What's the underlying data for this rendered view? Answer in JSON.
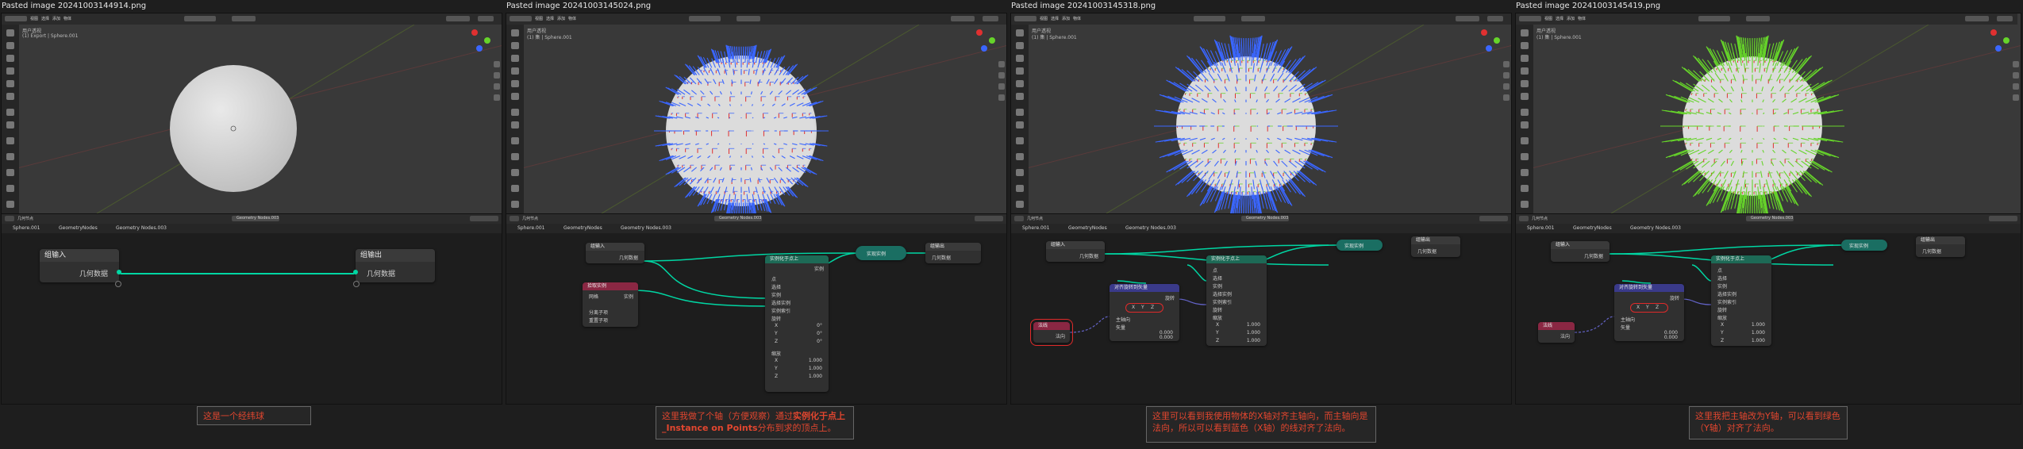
{
  "panels": [
    {
      "file_title": "Pasted image 20241003144914.png",
      "header_menu": [
        "物体模式",
        "视图",
        "选择",
        "添加",
        "物体"
      ],
      "viewport_info": [
        "用户透视",
        "(1) Export | Sphere.001"
      ],
      "editor_header": [
        "几何节点"
      ],
      "node_group": "Geometry Nodes.003",
      "breadcrumb": [
        "Sphere.001",
        "GeometryNodes",
        "Geometry Nodes.003"
      ],
      "nodes": {
        "group_input": {
          "title": "组输入",
          "socket": "几何数据"
        },
        "group_output": {
          "title": "组输出",
          "socket": "几何数据"
        }
      },
      "caption": "这是一个经纬球"
    },
    {
      "file_title": "Pasted image 20241003145024.png",
      "header_menu": [
        "物体模式",
        "视图",
        "选择",
        "添加",
        "物体"
      ],
      "viewport_info": [
        "用户透视",
        "(1) 集 | Sphere.001"
      ],
      "editor_header": [
        "几何节点"
      ],
      "node_group": "Geometry Nodes.003",
      "breadcrumb": [
        "Sphere.001",
        "GeometryNodes",
        "Geometry Nodes.003"
      ],
      "nodes": {
        "group_input": {
          "title": "组输入",
          "socket": "几何数据"
        },
        "group_output": {
          "title": "组输出",
          "socket": "几何数据"
        },
        "realize": {
          "title": "实现实例"
        },
        "instance": {
          "title": "实例化于点上",
          "rows": [
            "点",
            "选择",
            "实例",
            "选择实例",
            "实例索引",
            "旋转",
            "X",
            "Y",
            "Z",
            "缩放",
            "X",
            "Y",
            "Z"
          ],
          "values": [
            "0°",
            "0°",
            "0°",
            "1.000",
            "1.000",
            "1.000"
          ],
          "out": "实例"
        },
        "pick": {
          "title": "拾取实例",
          "rows": [
            "网格",
            "实例",
            "分离子项",
            "重置子项"
          ]
        }
      },
      "caption_pre": "这里我做了个轴（方便观察）通过",
      "caption_em": "实例化于点上_Instance on Points",
      "caption_post": "分布到求的顶点上。"
    },
    {
      "file_title": "Pasted image 20241003145318.png",
      "header_menu": [
        "物体模式",
        "视图",
        "选择",
        "添加",
        "物体"
      ],
      "viewport_info": [
        "用户透视",
        "(1) 集 | Sphere.001"
      ],
      "editor_header": [
        "几何节点"
      ],
      "node_group": "Geometry Nodes.003",
      "breadcrumb": [
        "Sphere.001",
        "GeometryNodes",
        "Geometry Nodes.003"
      ],
      "nodes": {
        "group_input": {
          "title": "组输入",
          "socket": "几何数据"
        },
        "group_output": {
          "title": "组输出",
          "socket": "几何数据"
        },
        "realize": {
          "title": "实现实例"
        },
        "instance": {
          "title": "实例化于点上",
          "rows": [
            "点",
            "选择",
            "实例",
            "选择实例",
            "实例索引",
            "旋转",
            "缩放",
            "X",
            "Y",
            "Z"
          ],
          "values": [
            "1.000",
            "1.000",
            "1.000"
          ]
        },
        "align": {
          "title": "对齐旋转到矢量",
          "mode": "旋转",
          "axes": [
            "X",
            "Y",
            "Z"
          ],
          "rows": [
            "主轴向",
            "矢量"
          ],
          "values": [
            "0.000",
            "0.000",
            "0.000"
          ]
        },
        "normal": {
          "title": "法线",
          "out": "法向"
        }
      },
      "caption": "这里可以看到我使用物体的X轴对齐主轴向，而主轴向是法向，所以可以看到蓝色（X轴）的线对齐了法向。"
    },
    {
      "file_title": "Pasted image 20241003145419.png",
      "header_menu": [
        "物体模式",
        "视图",
        "选择",
        "添加",
        "物体"
      ],
      "viewport_info": [
        "用户透视",
        "(1) 集 | Sphere.001"
      ],
      "editor_header": [
        "几何节点"
      ],
      "node_group": "Geometry Nodes.003",
      "breadcrumb": [
        "Sphere.001",
        "GeometryNodes",
        "Geometry Nodes.003"
      ],
      "nodes": {
        "group_input": {
          "title": "组输入",
          "socket": "几何数据"
        },
        "group_output": {
          "title": "组输出",
          "socket": "几何数据"
        },
        "realize": {
          "title": "实现实例"
        },
        "instance": {
          "title": "实例化于点上",
          "rows": [
            "点",
            "选择",
            "实例",
            "选择实例",
            "实例索引",
            "旋转",
            "缩放",
            "X",
            "Y",
            "Z"
          ],
          "values": [
            "1.000",
            "1.000",
            "1.000"
          ]
        },
        "align": {
          "title": "对齐旋转到矢量",
          "mode": "旋转",
          "axes": [
            "X",
            "Y",
            "Z"
          ],
          "rows": [
            "主轴向",
            "矢量"
          ],
          "values": [
            "0.000",
            "0.000",
            "0.000"
          ]
        },
        "normal": {
          "title": "法线",
          "out": "法向"
        }
      },
      "caption": "这里我把主轴改为Y轴，可以看到绿色（Y轴）对齐了法向。"
    }
  ],
  "colors": {
    "background": "#1e1e1e",
    "viewport": "#393939",
    "node_editor": "#1d1d1d",
    "geometry_link": "#00d6a3",
    "vector_link": "#6363c7",
    "highlight": "#e02a2a",
    "caption_text": "#e2462f",
    "axis_x": "#e03030",
    "axis_y": "#66d42a",
    "axis_z": "#3a66ff"
  }
}
